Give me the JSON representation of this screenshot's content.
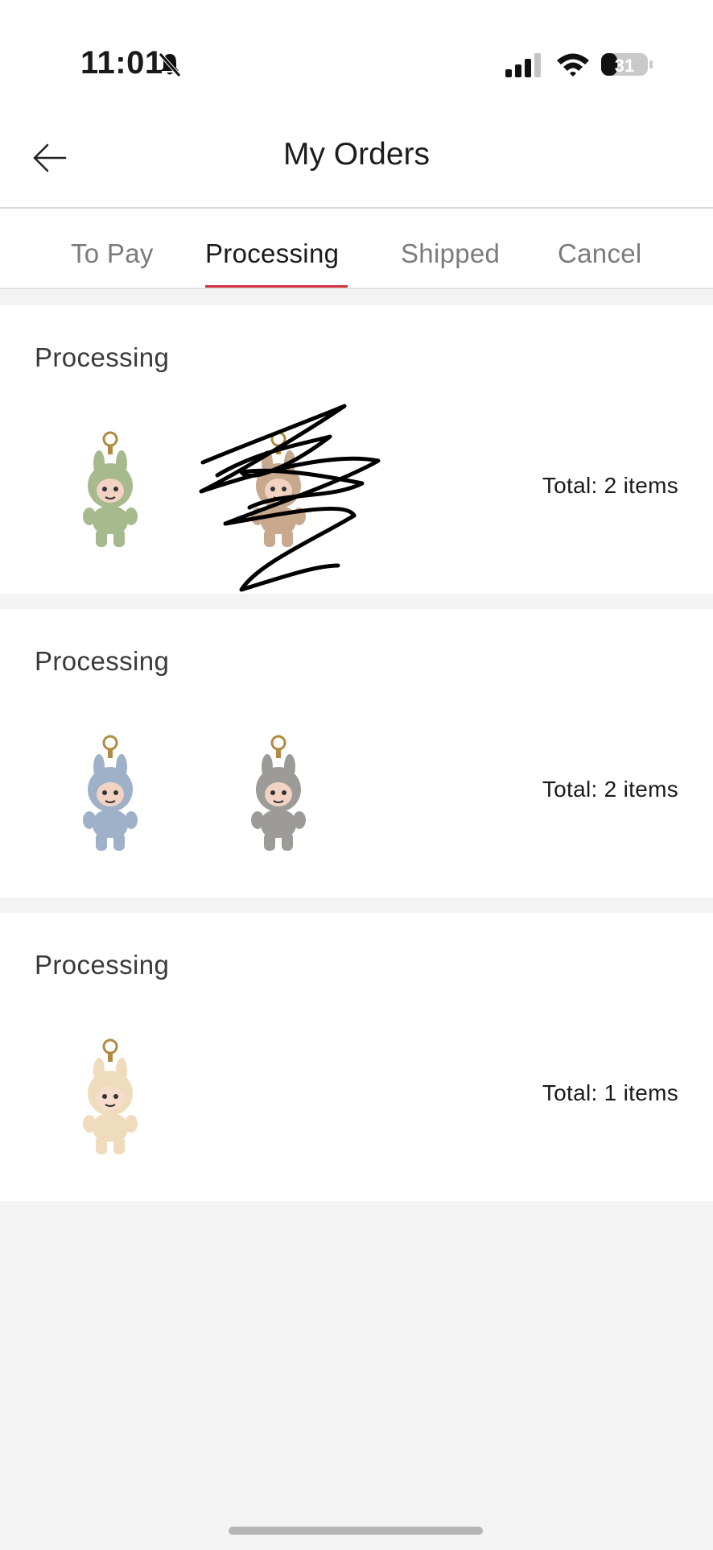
{
  "status_bar": {
    "time": "11:01",
    "battery": "31"
  },
  "header": {
    "title": "My Orders"
  },
  "tabs": [
    {
      "label": "To Pay"
    },
    {
      "label": "Processing"
    },
    {
      "label": "Shipped"
    },
    {
      "label": "Cancel"
    }
  ],
  "active_tab": "Processing",
  "orders": [
    {
      "status": "Processing",
      "total": "Total: 2 items",
      "item_colors": [
        "#a6ba8e",
        "#c9a98e"
      ]
    },
    {
      "status": "Processing",
      "total": "Total: 2 items",
      "item_colors": [
        "#9fb1c9",
        "#9c9b98"
      ]
    },
    {
      "status": "Processing",
      "total": "Total: 1 items",
      "item_colors": [
        "#efdcbd"
      ]
    }
  ],
  "colors": {
    "accent": "#d0313d",
    "background": "#f3f3f3"
  }
}
